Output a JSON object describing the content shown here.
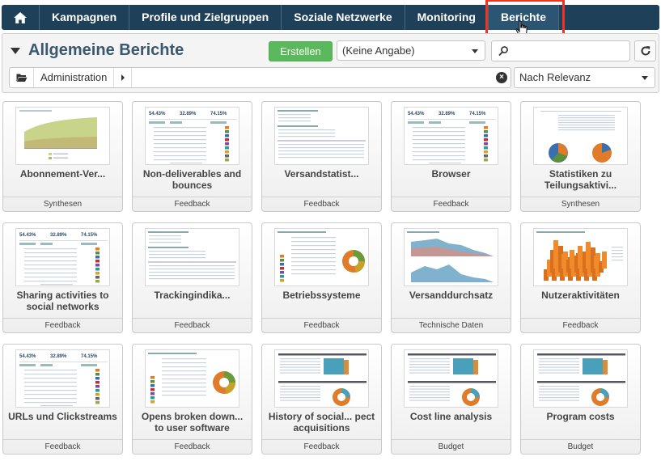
{
  "nav": {
    "home_icon": "home-icon",
    "items": [
      {
        "label": "Kampagnen"
      },
      {
        "label": "Profile und Zielgruppen"
      },
      {
        "label": "Soziale Netzwerke"
      },
      {
        "label": "Monitoring"
      },
      {
        "label": "Berichte",
        "active": true
      }
    ]
  },
  "panel": {
    "title": "Allgemeine Berichte",
    "create_button": "Erstellen",
    "filter_select": "(Keine Angabe)",
    "search_placeholder": "",
    "folder_label": "Administration",
    "sort_select": "Nach Relevanz"
  },
  "cards": [
    {
      "title": "Abonnement-Ver...",
      "category": "Synthesen",
      "thumb": "area-chart"
    },
    {
      "title": "Non-deliverables and bounces",
      "category": "Feedback",
      "thumb": "stats-table"
    },
    {
      "title": "Versandstatist...",
      "category": "Feedback",
      "thumb": "form-table"
    },
    {
      "title": "Browser",
      "category": "Feedback",
      "thumb": "stats-table"
    },
    {
      "title": "Statistiken zu Teilungsaktivi...",
      "category": "Synthesen",
      "thumb": "pies"
    },
    {
      "title": "Sharing activities to social networks",
      "category": "Feedback",
      "thumb": "stats-table"
    },
    {
      "title": "Trackingindika...",
      "category": "Feedback",
      "thumb": "form-table"
    },
    {
      "title": "Betriebssysteme",
      "category": "Feedback",
      "thumb": "donut-table"
    },
    {
      "title": "Versanddurchsatz",
      "category": "Technische Daten",
      "thumb": "blue-area"
    },
    {
      "title": "Nutzeraktivitäten",
      "category": "Feedback",
      "thumb": "bars-3d"
    },
    {
      "title": "URLs und Clickstreams",
      "category": "Feedback",
      "thumb": "stats-table"
    },
    {
      "title": "Opens broken down... to user software",
      "category": "Feedback",
      "thumb": "donut-table"
    },
    {
      "title": "History of social... pect acquisitions",
      "category": "Feedback",
      "thumb": "budget"
    },
    {
      "title": "Cost line analysis",
      "category": "Budget",
      "thumb": "budget"
    },
    {
      "title": "Program costs",
      "category": "Budget",
      "thumb": "budget"
    }
  ],
  "colors": {
    "nav_bg": "#1f4059",
    "highlight": "#ee3322",
    "create_green": "#5cb85c",
    "title_blue": "#3a5870"
  }
}
